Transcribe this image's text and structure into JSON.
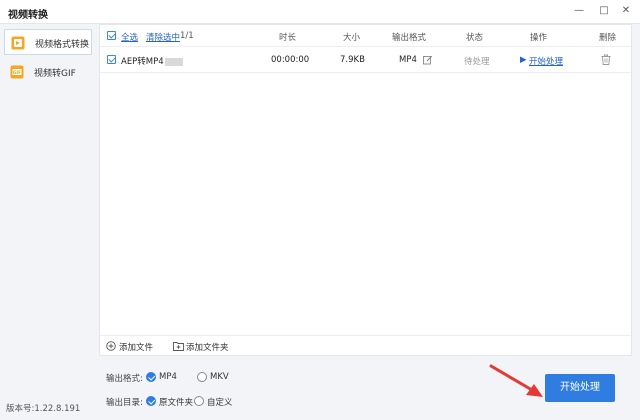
{
  "window": {
    "title": "视频转换",
    "minimize": "—",
    "maximize": "□",
    "close": "✕"
  },
  "sidebar": {
    "items": [
      {
        "label": "视频格式转换",
        "icon": "video-convert-icon",
        "active": true
      },
      {
        "label": "视频转GIF",
        "icon": "gif-icon",
        "active": false
      }
    ],
    "version": "版本号:1.22.8.191"
  },
  "table": {
    "select_all": "全选",
    "clear_selected": "清除选中",
    "count": "1/1",
    "headers": {
      "duration": "时长",
      "size": "大小",
      "format": "输出格式",
      "status": "状态",
      "action": "操作",
      "delete": "删除"
    },
    "rows": [
      {
        "name": "AEP转MP4",
        "duration": "00:00:00",
        "size": "7.9KB",
        "format": "MP4",
        "status": "待处理",
        "action": "开始处理"
      }
    ]
  },
  "footer": {
    "add_file": "添加文件",
    "add_folder": "添加文件夹"
  },
  "options": {
    "format_label": "输出格式:",
    "format_options": [
      "MP4",
      "MKV"
    ],
    "format_selected": "MP4",
    "dir_label": "输出目录:",
    "dir_options": [
      "原文件夹",
      "自定义"
    ],
    "dir_selected": "原文件夹"
  },
  "start_button": "开始处理",
  "colors": {
    "accent": "#2f7de1",
    "link": "#2563c9",
    "arrow": "#e53935"
  }
}
